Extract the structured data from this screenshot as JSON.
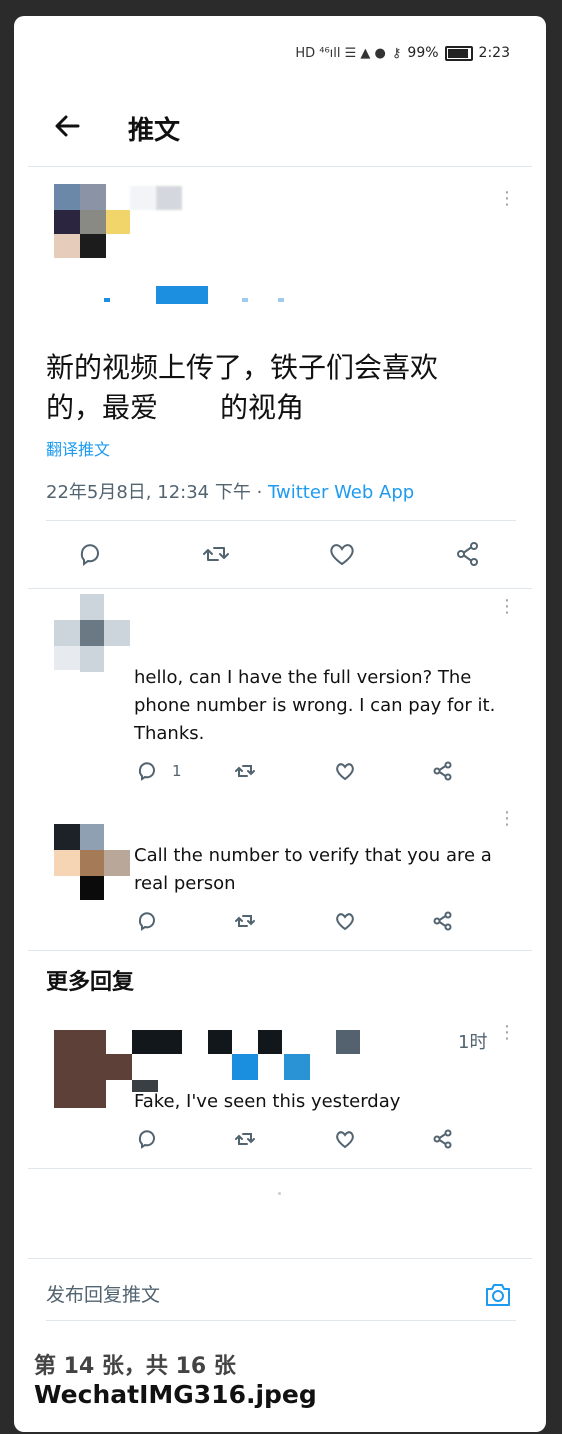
{
  "status_bar": {
    "left_icons": "HD ⁴⁶ıll ☰ ▲ ●",
    "battery": "99%",
    "time": "2:23"
  },
  "header": {
    "title": "推文"
  },
  "main_tweet": {
    "text_line1": "新的视频上传了，铁子们会喜欢",
    "text_line2_part1": "的，最爱",
    "text_line2_part2": "的视角",
    "translate_label": "翻译推文",
    "date": "22年5月8日, 12:34 下午 · ",
    "source": "Twitter Web App"
  },
  "replies": [
    {
      "text_lines": [
        "hello, can I have the full version? The",
        "phone number is wrong. I can pay for it.",
        "Thanks."
      ],
      "reply_count": "1"
    },
    {
      "text_lines": [
        "Call the number to verify that you are a",
        "real person"
      ]
    }
  ],
  "more_replies": {
    "title": "更多回复",
    "time": "1时",
    "text": "Fake, I've seen this yesterday"
  },
  "compose": {
    "placeholder": "发布回复推文"
  },
  "caption": {
    "counter": "第 14 张，共 16 张",
    "filename": "WechatIMG316.jpeg"
  },
  "colors": {
    "link": "#1d9bf0",
    "muted": "#536471"
  }
}
